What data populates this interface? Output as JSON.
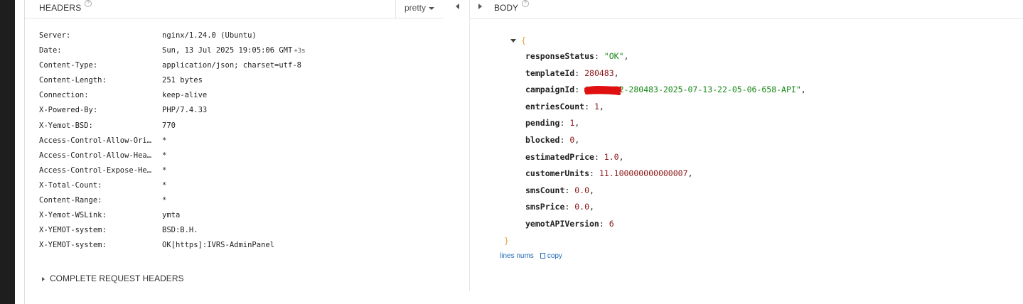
{
  "headers_pane": {
    "title": "HEADERS",
    "help": "?",
    "view_select": "pretty",
    "rows": [
      {
        "key": "Server:",
        "value": "nginx/1.24.0 (Ubuntu)"
      },
      {
        "key": "Date:",
        "value": "Sun, 13 Jul 2025 19:05:06 GMT",
        "extra": "+3s"
      },
      {
        "key": "Content-Type:",
        "value": "application/json; charset=utf-8"
      },
      {
        "key": "Content-Length:",
        "value": "251 bytes"
      },
      {
        "key": "Connection:",
        "value": "keep-alive"
      },
      {
        "key": "X-Powered-By:",
        "value": "PHP/7.4.33"
      },
      {
        "key": "X-Yemot-BSD:",
        "value": "770"
      },
      {
        "key": "Access-Control-Allow-Ori…",
        "value": "*"
      },
      {
        "key": "Access-Control-Allow-Hea…",
        "value": "*"
      },
      {
        "key": "Access-Control-Expose-He…",
        "value": "*"
      },
      {
        "key": "X-Total-Count:",
        "value": "*"
      },
      {
        "key": "Content-Range:",
        "value": "*"
      },
      {
        "key": "X-Yemot-WSLink:",
        "value": "ymta"
      },
      {
        "key": "X-YEMOT-system:",
        "value": "BSD:B.H."
      },
      {
        "key": "X-YEMOT-system:",
        "value": "OK[https]:IVRS-AdminPanel"
      }
    ],
    "complete_request": "COMPLETE REQUEST HEADERS"
  },
  "body_pane": {
    "title": "BODY",
    "help": "?",
    "open_brace": "{",
    "close_brace": "}",
    "fields": [
      {
        "key": "responseStatus",
        "value": "\"OK\"",
        "type": "str"
      },
      {
        "key": "templateId",
        "value": "280483",
        "type": "num"
      },
      {
        "key": "campaignId",
        "value": "\"077-           52-280483-2025-07-13-22-05-06-658-API\"",
        "type": "str"
      },
      {
        "key": "entriesCount",
        "value": "1",
        "type": "num"
      },
      {
        "key": "pending",
        "value": "1",
        "type": "num"
      },
      {
        "key": "blocked",
        "value": "0",
        "type": "num"
      },
      {
        "key": "estimatedPrice",
        "value": "1.0",
        "type": "num"
      },
      {
        "key": "customerUnits",
        "value": "11.100000000000007",
        "type": "num"
      },
      {
        "key": "smsCount",
        "value": "0.0",
        "type": "num"
      },
      {
        "key": "smsPrice",
        "value": "0.0",
        "type": "num"
      },
      {
        "key": "yemotAPIVersion",
        "value": "6",
        "type": "num"
      }
    ],
    "links": {
      "lines_nums": "lines nums",
      "copy": "copy"
    }
  },
  "colors": {
    "string": "#1a8a1a",
    "number": "#8b1a1a",
    "brace": "#e8a33d",
    "link": "#1f6bb5",
    "redaction": "#e01010"
  }
}
